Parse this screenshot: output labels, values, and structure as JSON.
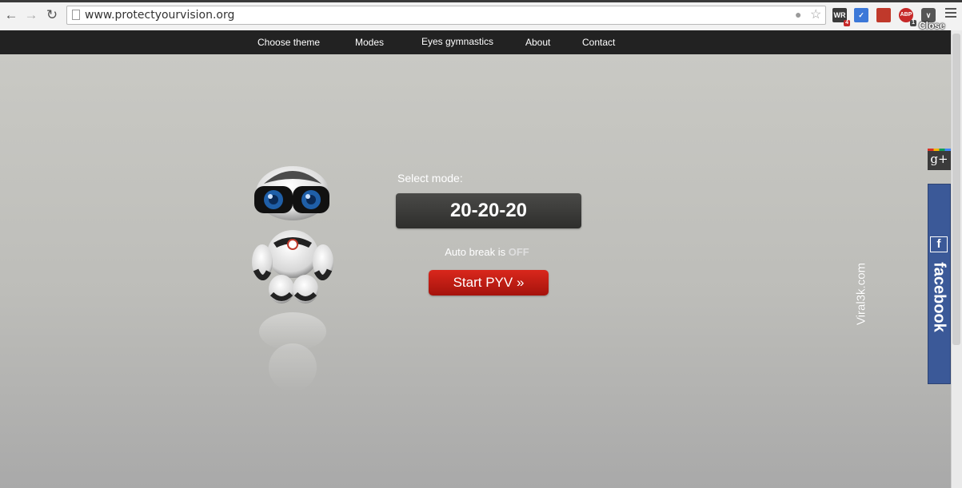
{
  "browser": {
    "url": "www.protectyourvision.org",
    "close_label": "Close",
    "extensions": [
      {
        "name": "wr-extension",
        "label": "WR",
        "badge": "4",
        "color": "#3a3a3a"
      },
      {
        "name": "checkmark-extension",
        "label": "✓",
        "badge": "",
        "color": "#3c78d8"
      },
      {
        "name": "book-extension",
        "label": "",
        "badge": "",
        "color": "#c0392b"
      },
      {
        "name": "adblock-extension",
        "label": "ABP",
        "badge": "1",
        "color": "#c62828"
      },
      {
        "name": "pocket-extension",
        "label": "",
        "badge": "",
        "color": "#555555"
      }
    ]
  },
  "nav": {
    "items": [
      "Choose theme",
      "Modes",
      "Eyes gymnastics",
      "About",
      "Contact"
    ]
  },
  "main": {
    "select_label": "Select mode:",
    "mode": "20-20-20",
    "auto_break_text": "Auto break is",
    "auto_break_state": "OFF",
    "start_button": "Start PYV »"
  },
  "watermark": "Viral3k.com",
  "social": {
    "gplus_label": "g+",
    "facebook_label": "facebook",
    "facebook_icon": "f"
  },
  "colors": {
    "nav_bg": "#222222",
    "start_button": "#c41e14",
    "mode_box": "#3a3a38",
    "facebook": "#3b5998"
  }
}
